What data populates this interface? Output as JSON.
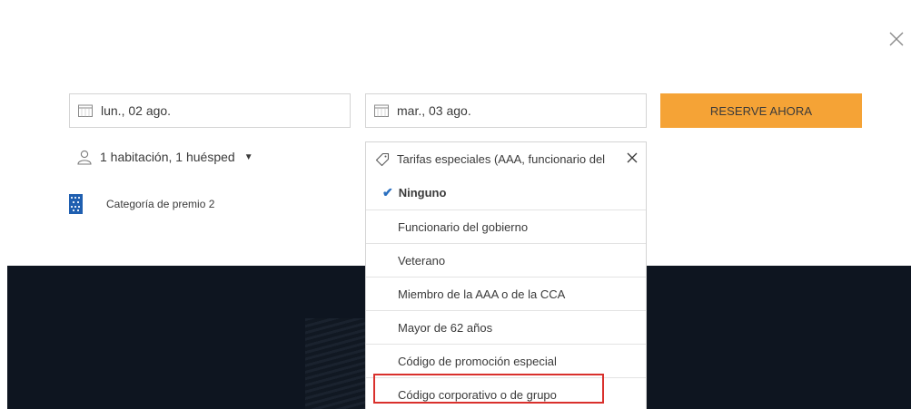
{
  "dates": {
    "checkin": "lun., 02 ago.",
    "checkout": "mar., 03 ago."
  },
  "reserve_label": "RESERVE AHORA",
  "guests": "1 habitación, 1 huésped",
  "award_category": "Categoría de premio 2",
  "rates": {
    "selected_label": "Tarifas especiales (AAA, funcionario del",
    "options": [
      "Ninguno",
      "Funcionario del gobierno",
      "Veterano",
      "Miembro de la AAA o de la CCA",
      "Mayor de 62 años",
      "Código de promoción especial",
      "Código corporativo o de grupo"
    ],
    "checked_index": 0
  },
  "colors": {
    "accent": "#f5a336",
    "hero": "#0e1520",
    "check": "#2a6fc0",
    "highlight": "#d9302c"
  },
  "icons": [
    "close-icon",
    "calendar-icon",
    "person-icon",
    "caret-down-icon",
    "tag-icon",
    "clear-icon",
    "check-icon",
    "award-logo"
  ]
}
